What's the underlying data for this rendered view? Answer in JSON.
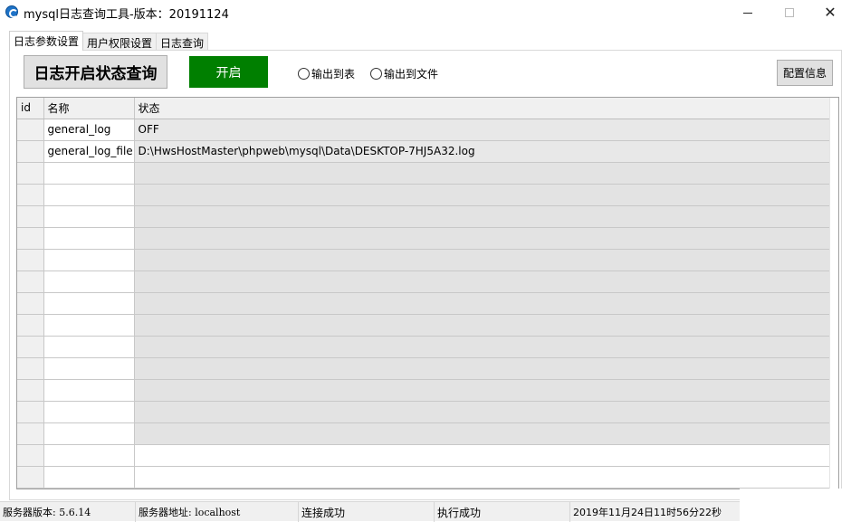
{
  "window": {
    "title": "mysql日志查询工具-版本：20191124",
    "icon": "app-logo-icon"
  },
  "tabs": [
    {
      "label": "日志参数设置",
      "active": true
    },
    {
      "label": "用户权限设置",
      "active": false
    },
    {
      "label": "日志查询",
      "active": false
    }
  ],
  "toolbar": {
    "query_button": "日志开启状态查询",
    "open_button": "开启",
    "open_button_color": "#007f00",
    "radio_table": "输出到表",
    "radio_file": "输出到文件",
    "config_button": "配置信息"
  },
  "grid": {
    "columns": [
      "id",
      "名称",
      "状态"
    ],
    "rows": [
      {
        "id": "",
        "name": "general_log",
        "state": "OFF"
      },
      {
        "id": "",
        "name": "general_log_file",
        "state": "D:\\HwsHostMaster\\phpweb\\mysql\\Data\\DESKTOP-7HJ5A32.log"
      }
    ]
  },
  "statusbar": {
    "server_version": "服务器版本: 5.6.14",
    "server_address": "服务器地址: localhost",
    "connection": "连接成功",
    "execution": "执行成功",
    "timestamp": "2019年11月24日11时56分22秒"
  }
}
